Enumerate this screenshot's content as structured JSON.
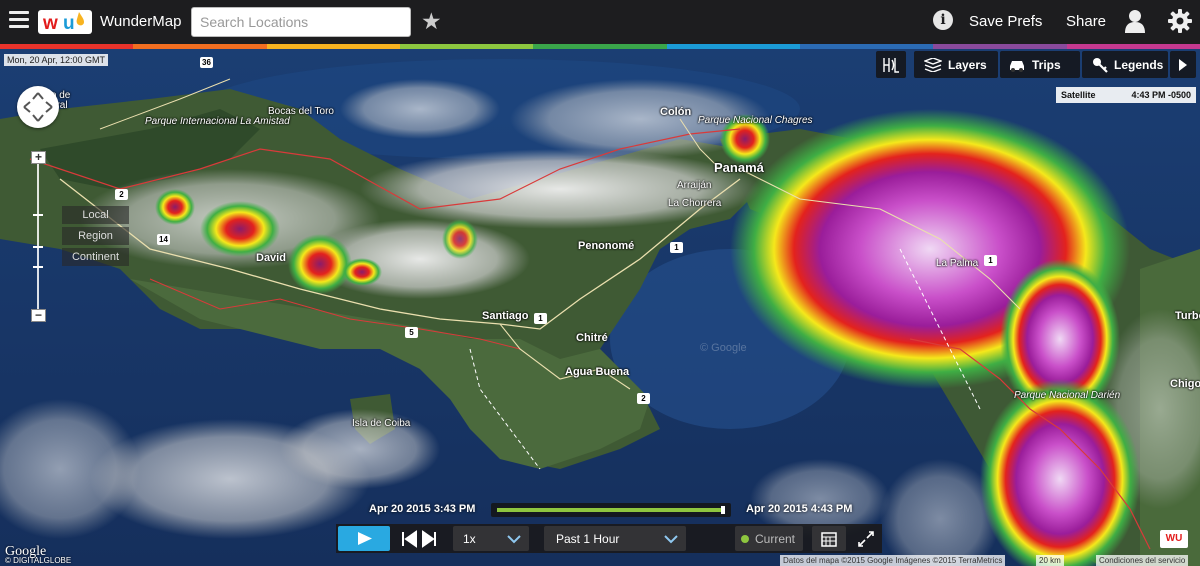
{
  "header": {
    "app_title": "WunderMap",
    "search_placeholder": "Search Locations",
    "save_prefs": "Save Prefs",
    "share": "Share",
    "rainbow_colors": [
      "#e8332b",
      "#f26e21",
      "#f8b320",
      "#8dc63f",
      "#3aa54a",
      "#1b9bd7",
      "#2b6bb4",
      "#8a4a9c",
      "#c5398f"
    ]
  },
  "map": {
    "date_stamp": "Mon, 20 Apr, 12:00 GMT",
    "toolbar": {
      "hl_label": "H/L",
      "layers": "Layers",
      "trips": "Trips",
      "legends": "Legends"
    },
    "status": {
      "layer": "Satellite",
      "time": "4:43 PM -0500"
    },
    "zoom_levels": [
      "Local",
      "Region",
      "Continent"
    ],
    "places": [
      "Bocas del Toro",
      "Parque Internacional La Amistad",
      "David",
      "Santiago",
      "Penonomé",
      "Chitré",
      "Agua Buena",
      "Isla de Coiba",
      "Colón",
      "Parque Nacional Chagres",
      "Panamá",
      "Arraiján",
      "La Chorrera",
      "La Palma",
      "Parque Nacional Darién",
      "Turbo",
      "Chigoro",
      "Isidro de",
      "General"
    ],
    "routes": [
      "36",
      "2",
      "14",
      "1",
      "5",
      "1",
      "2",
      "1"
    ],
    "watermark": "© Google",
    "google": "Google",
    "google_sub": "© DIGITALGLOBE",
    "attribution": "Datos del mapa ©2015 Google Imágenes ©2015 TerraMetrics",
    "scale": "20 km",
    "terms": "Condiciones del servicio",
    "wu_badge": "WU"
  },
  "timeline": {
    "start": "Apr 20 2015 3:43 PM",
    "end": "Apr 20 2015 4:43 PM",
    "progress_fraction": 1.0,
    "speed": "1x",
    "range": "Past 1 Hour",
    "current": "Current"
  }
}
